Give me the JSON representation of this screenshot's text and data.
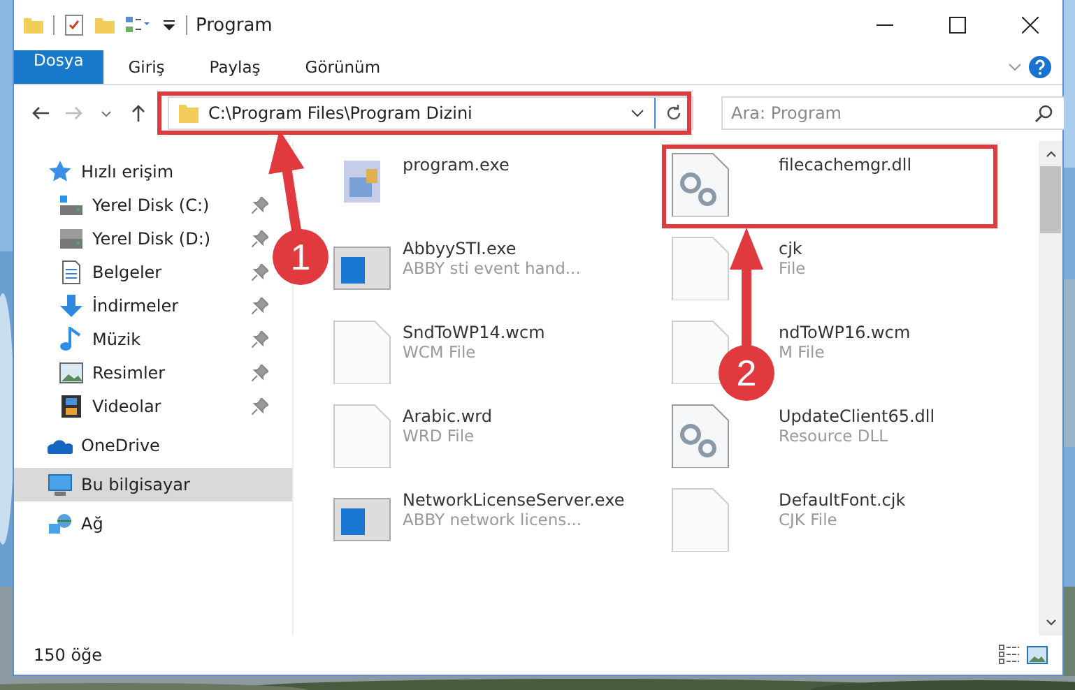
{
  "window": {
    "title": "Program"
  },
  "ribbon_tabs": [
    {
      "label": "Dosya",
      "selected": true
    },
    {
      "label": "Giriş",
      "selected": false
    },
    {
      "label": "Paylaş",
      "selected": false
    },
    {
      "label": "Görünüm",
      "selected": false
    }
  ],
  "address_bar": {
    "path": "C:\\Program Files\\Program Dizini"
  },
  "search": {
    "placeholder": "Ara: Program"
  },
  "sidebar": {
    "items": [
      {
        "label": "Hızlı erişim",
        "selected": false,
        "children": [
          {
            "label": "Yerel Disk (C:)",
            "pinned": true
          },
          {
            "label": "Yerel Disk (D:)",
            "pinned": true
          },
          {
            "label": "Belgeler",
            "pinned": true
          },
          {
            "label": "İndirmeler",
            "pinned": true
          },
          {
            "label": "Müzik",
            "pinned": true
          },
          {
            "label": "Resimler",
            "pinned": true
          },
          {
            "label": "Videolar",
            "pinned": true
          }
        ]
      },
      {
        "label": "OneDrive",
        "selected": false
      },
      {
        "label": "Bu bilgisayar",
        "selected": true
      },
      {
        "label": "Ağ",
        "selected": false
      }
    ]
  },
  "files": [
    {
      "name": "program.exe",
      "kind": "installer"
    },
    {
      "name": "filecachemgr.dll",
      "kind": "dll"
    },
    {
      "name": "AbbyySTI.exe",
      "type": "ABBY sti event hand...",
      "kind": "app"
    },
    {
      "name": "cjk",
      "type": "File",
      "kind": "blank"
    },
    {
      "name": "SndToWP14.wcm",
      "type": "WCM File",
      "kind": "blank"
    },
    {
      "name": "ndToWP16.wcm",
      "type": "M File",
      "kind": "blank"
    },
    {
      "name": "Arabic.wrd",
      "type": "WRD File",
      "kind": "blank"
    },
    {
      "name": "UpdateClient65.dll",
      "type": "Resource DLL",
      "kind": "dll"
    },
    {
      "name": "NetworkLicenseServer.exe",
      "type": "ABBY network licens...",
      "kind": "app"
    },
    {
      "name": "DefaultFont.cjk",
      "type": "CJK File",
      "kind": "blank"
    }
  ],
  "status_bar": {
    "count": "150 öğe"
  },
  "annotations": [
    {
      "label": "1"
    },
    {
      "label": "2"
    }
  ]
}
